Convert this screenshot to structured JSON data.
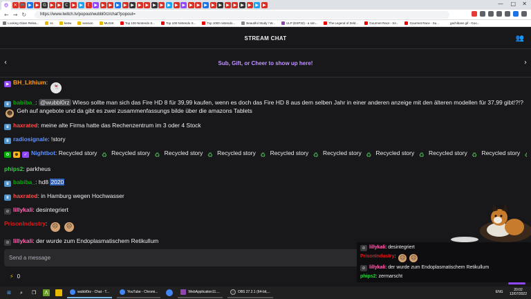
{
  "browser": {
    "url": "https://www.twitch.tv/popout/wubbl0rz/chat?popout=",
    "tabs_icons": [
      "🐵",
      "✕",
      "🎮",
      "▶",
      "▶",
      "G",
      "▶",
      "▶",
      "C",
      "▶",
      "▶",
      "t",
      "▶",
      "▶",
      "▶",
      "▶",
      "▶",
      "▶",
      "▶",
      "▶",
      "▶",
      "▶",
      "▶",
      "▶",
      "▶",
      "▶",
      "▶",
      "▶",
      "▶",
      "▶",
      "▶",
      "▶",
      "▶",
      "▶",
      "▶",
      "▶"
    ],
    "bookmarks": [
      "Looking Glass Relea...",
      "ss",
      "ke6w",
      "session",
      "MUSIK",
      "Top 100 Nintendo S...",
      "Top 100 Nintendo S...",
      "Top 1000 nintendo...",
      "Beautiful Study / W...",
      "ULP (ESP32) - a sim...",
      "The Legend of Zeld...",
      "Gourmet Race - Kir...",
      "Gourmet Race - Su...",
      "gachibass gif - Goo..."
    ]
  },
  "chat": {
    "header_title": "STREAM CHAT",
    "promo_text": "Sub, Gift, or Cheer to show up here!",
    "send_placeholder": "Send a message",
    "points_value": "0",
    "messages": [
      {
        "name": "BH_Lithium",
        "color": "#ff9f1c",
        "sep": ":",
        "text": ""
      },
      {
        "name": "babiba_",
        "color": "#00ad03",
        "sep": ":",
        "mention": "@wubbl0rz",
        "text": "WIeso sollte man sich das Fire HD 8 für 39,99 kaufen, wenn es doch das Fire HD 8 aus dem selben Jahr in einer anderen anzeige mit den älteren modellen für 37,99 gibt!?!?",
        "text2": "Geh auf angebote und da gibt es zwei zusammenfassungs bilde über die amazons Tablets"
      },
      {
        "name": "haxrated",
        "color": "#ff4d4d",
        "sep": ":",
        "text": "meine alte Firma hatte das Rechenzentrum im 3 oder 4 Stock"
      },
      {
        "name": "radiosignale",
        "color": "#5f91ff",
        "sep": ":",
        "text": "!story"
      },
      {
        "name": "Nightbot",
        "color": "#5f91ff",
        "sep": ":",
        "text": "Recycled story"
      },
      {
        "name": "phips2",
        "color": "#2ecc40",
        "sep": ":",
        "text": "parkheus"
      },
      {
        "name": "babiba_",
        "color": "#00ad03",
        "sep": ":",
        "text": "hd8",
        "highlight": "2020"
      },
      {
        "name": "haxrated",
        "color": "#ff4d4d",
        "sep": ":",
        "text": "in Hamburg wegen Hochwasser"
      },
      {
        "name": "lillykali",
        "color": "#ff69b4",
        "sep": ":",
        "text": "desintegriert"
      },
      {
        "name": "PrisonIndustry",
        "color": "#e01b1b",
        "sep": ":",
        "text": ""
      },
      {
        "name": "lillykali",
        "color": "#ff69b4",
        "sep": ":",
        "text": "der wurde zum Endoplasmatischem Retikullum"
      },
      {
        "name": "phips2",
        "color": "#2ecc40",
        "sep": ":",
        "text": "zermarscht"
      }
    ]
  },
  "overlay": {
    "messages": [
      {
        "name": "lillykali",
        "sep": ":",
        "text": "desintegriert"
      },
      {
        "name": "PrisonIndustry",
        "sep": ":",
        "text": ""
      },
      {
        "name": "lillykali",
        "sep": ":",
        "text": "der wurde zum Endoplasmatischem Retikullum"
      },
      {
        "name": "phips2",
        "sep": ":",
        "text": "zermarscht"
      }
    ]
  },
  "taskbar": {
    "apps": [
      "wubbl0rz - Chat - T...",
      "YouTube - Chromi...",
      "WebApplication11....",
      "OBS 27.2.1 (64-bit,..."
    ],
    "time": "20:02",
    "date": "12/07/2022",
    "lang": "ENG"
  },
  "colors": {
    "accent": "#9146ff",
    "promo": "#bf94ff"
  }
}
